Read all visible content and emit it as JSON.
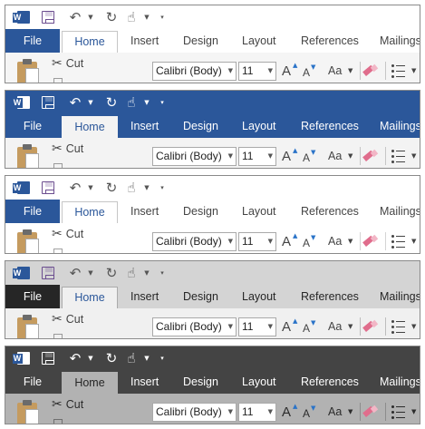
{
  "app": "Word",
  "quick_access": {
    "word_badge": "W",
    "save_icon": "save-icon",
    "undo_icon": "undo-icon",
    "redo_icon": "redo-icon",
    "touch_icon": "touch-mouse-mode-icon",
    "customize_icon": "customize-quick-access-icon"
  },
  "tabs": [
    {
      "label": "File"
    },
    {
      "label": "Home"
    },
    {
      "label": "Insert"
    },
    {
      "label": "Design"
    },
    {
      "label": "Layout"
    },
    {
      "label": "References"
    },
    {
      "label": "Mailings"
    }
  ],
  "ribbon": {
    "paste_icon": "paste-icon",
    "cut_label": "Cut",
    "font_name": "Calibri (Body)",
    "font_size": "11",
    "grow_label": "A",
    "shrink_label": "A",
    "change_case_label": "Aa",
    "clear_formatting_icon": "clear-formatting-icon",
    "bullets_icon": "bullets-icon"
  },
  "themes": [
    {
      "name": "Colorful",
      "title_bg": "#ffffff",
      "tab_bg": "#ffffff",
      "ribbon_bg": "#f5f5f5",
      "file_bg": "#2b579a",
      "file_fg": "#ffffff",
      "tab_fg": "#444444",
      "qat_fg": "#555555",
      "home_bg": "#ffffff",
      "home_fg": "#2b579a",
      "home_border": "#c6c6c6",
      "ribbon_fg": "#444444",
      "sep": "#c6c6c6",
      "logo": "#2b579a",
      "save": "#6b4d8f"
    },
    {
      "name": "Colorful-Blue",
      "title_bg": "#2b579a",
      "tab_bg": "#2b579a",
      "ribbon_bg": "#f3f3f3",
      "file_bg": "#2b579a",
      "file_fg": "#ffffff",
      "tab_fg": "#ffffff",
      "qat_fg": "#ffffff",
      "home_bg": "#f3f3f3",
      "home_fg": "#2b579a",
      "home_border": "#f3f3f3",
      "ribbon_fg": "#444444",
      "sep": "#c6c6c6",
      "logo": "#ffffff",
      "save": "#ffffff"
    },
    {
      "name": "White",
      "title_bg": "#ffffff",
      "tab_bg": "#ffffff",
      "ribbon_bg": "#ffffff",
      "file_bg": "#2b579a",
      "file_fg": "#ffffff",
      "tab_fg": "#444444",
      "qat_fg": "#555555",
      "home_bg": "#ffffff",
      "home_fg": "#2b579a",
      "home_border": "#c6c6c6",
      "ribbon_fg": "#444444",
      "sep": "#d4d4d4",
      "logo": "#2b579a",
      "save": "#6b4d8f"
    },
    {
      "name": "Dark Gray",
      "title_bg": "#d4d4d4",
      "tab_bg": "#d4d4d4",
      "ribbon_bg": "#f0f0f0",
      "file_bg": "#262626",
      "file_fg": "#ffffff",
      "tab_fg": "#262626",
      "qat_fg": "#555555",
      "home_bg": "#f0f0f0",
      "home_fg": "#2b579a",
      "home_border": "#ababab",
      "ribbon_fg": "#444444",
      "sep": "#bdbdbd",
      "logo": "#2b579a",
      "save": "#6b4d8f"
    },
    {
      "name": "Black",
      "title_bg": "#444444",
      "tab_bg": "#444444",
      "ribbon_bg": "#b2b2b2",
      "file_bg": "#444444",
      "file_fg": "#ffffff",
      "tab_fg": "#ffffff",
      "qat_fg": "#ffffff",
      "home_bg": "#b2b2b2",
      "home_fg": "#262626",
      "home_border": "#b2b2b2",
      "ribbon_fg": "#2b2b2b",
      "sep": "#8c8c8c",
      "logo": "#ffffff",
      "save": "#ffffff"
    }
  ]
}
